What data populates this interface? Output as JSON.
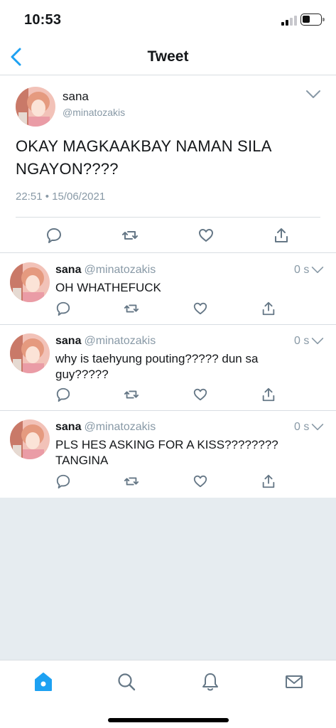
{
  "status_bar": {
    "time": "10:53"
  },
  "nav": {
    "title": "Tweet",
    "back_icon": "chevron-left-icon"
  },
  "main_tweet": {
    "name": "sana",
    "handle": "@minatozakis",
    "text": "OKAY MAGKAAKBAY NAMAN SILA NGAYON????",
    "timestamp": "22:51 • 15/06/2021"
  },
  "replies": [
    {
      "name": "sana",
      "handle": "@minatozakis",
      "time": "0 s",
      "text": "OH WHATHEFUCK"
    },
    {
      "name": "sana",
      "handle": "@minatozakis",
      "time": "0 s",
      "text": "why is taehyung pouting????? dun sa guy?????"
    },
    {
      "name": "sana",
      "handle": "@minatozakis",
      "time": "0 s",
      "text": "PLS HES ASKING FOR A KISS???????? TANGINA"
    }
  ],
  "tab_bar": {
    "items": [
      "home-icon",
      "search-icon",
      "notifications-icon",
      "messages-icon"
    ],
    "active": "home-icon"
  },
  "colors": {
    "accent": "#1da1f2",
    "icon_gray": "#657786",
    "secondary_text": "#8899a6",
    "background_filler": "#e6ecf0"
  }
}
